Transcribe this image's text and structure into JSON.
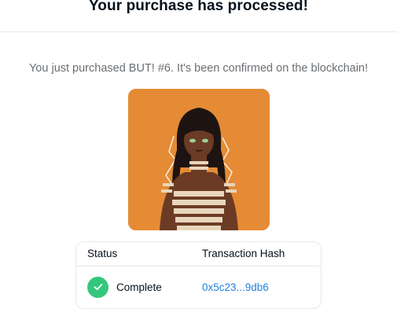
{
  "header": {
    "title": "Your purchase has processed!"
  },
  "message": "You just purchased BUT! #6. It's been confirmed on the blockchain!",
  "nft": {
    "icon": "nft-artwork-image",
    "background_color": "#e58b35"
  },
  "transaction_table": {
    "columns": [
      "Status",
      "Transaction Hash"
    ],
    "row": {
      "status_icon": "check-icon",
      "status": "Complete",
      "hash": "0x5c23...9db6"
    },
    "status_color": "#34c77b",
    "link_color": "#2081e2"
  }
}
